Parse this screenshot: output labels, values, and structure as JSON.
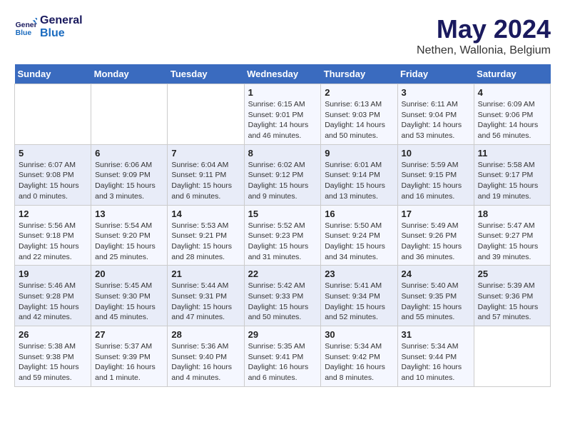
{
  "logo": {
    "line1": "General",
    "line2": "Blue"
  },
  "title": "May 2024",
  "subtitle": "Nethen, Wallonia, Belgium",
  "days_header": [
    "Sunday",
    "Monday",
    "Tuesday",
    "Wednesday",
    "Thursday",
    "Friday",
    "Saturday"
  ],
  "weeks": [
    [
      {
        "day": "",
        "detail": ""
      },
      {
        "day": "",
        "detail": ""
      },
      {
        "day": "",
        "detail": ""
      },
      {
        "day": "1",
        "detail": "Sunrise: 6:15 AM\nSunset: 9:01 PM\nDaylight: 14 hours\nand 46 minutes."
      },
      {
        "day": "2",
        "detail": "Sunrise: 6:13 AM\nSunset: 9:03 PM\nDaylight: 14 hours\nand 50 minutes."
      },
      {
        "day": "3",
        "detail": "Sunrise: 6:11 AM\nSunset: 9:04 PM\nDaylight: 14 hours\nand 53 minutes."
      },
      {
        "day": "4",
        "detail": "Sunrise: 6:09 AM\nSunset: 9:06 PM\nDaylight: 14 hours\nand 56 minutes."
      }
    ],
    [
      {
        "day": "5",
        "detail": "Sunrise: 6:07 AM\nSunset: 9:08 PM\nDaylight: 15 hours\nand 0 minutes."
      },
      {
        "day": "6",
        "detail": "Sunrise: 6:06 AM\nSunset: 9:09 PM\nDaylight: 15 hours\nand 3 minutes."
      },
      {
        "day": "7",
        "detail": "Sunrise: 6:04 AM\nSunset: 9:11 PM\nDaylight: 15 hours\nand 6 minutes."
      },
      {
        "day": "8",
        "detail": "Sunrise: 6:02 AM\nSunset: 9:12 PM\nDaylight: 15 hours\nand 9 minutes."
      },
      {
        "day": "9",
        "detail": "Sunrise: 6:01 AM\nSunset: 9:14 PM\nDaylight: 15 hours\nand 13 minutes."
      },
      {
        "day": "10",
        "detail": "Sunrise: 5:59 AM\nSunset: 9:15 PM\nDaylight: 15 hours\nand 16 minutes."
      },
      {
        "day": "11",
        "detail": "Sunrise: 5:58 AM\nSunset: 9:17 PM\nDaylight: 15 hours\nand 19 minutes."
      }
    ],
    [
      {
        "day": "12",
        "detail": "Sunrise: 5:56 AM\nSunset: 9:18 PM\nDaylight: 15 hours\nand 22 minutes."
      },
      {
        "day": "13",
        "detail": "Sunrise: 5:54 AM\nSunset: 9:20 PM\nDaylight: 15 hours\nand 25 minutes."
      },
      {
        "day": "14",
        "detail": "Sunrise: 5:53 AM\nSunset: 9:21 PM\nDaylight: 15 hours\nand 28 minutes."
      },
      {
        "day": "15",
        "detail": "Sunrise: 5:52 AM\nSunset: 9:23 PM\nDaylight: 15 hours\nand 31 minutes."
      },
      {
        "day": "16",
        "detail": "Sunrise: 5:50 AM\nSunset: 9:24 PM\nDaylight: 15 hours\nand 34 minutes."
      },
      {
        "day": "17",
        "detail": "Sunrise: 5:49 AM\nSunset: 9:26 PM\nDaylight: 15 hours\nand 36 minutes."
      },
      {
        "day": "18",
        "detail": "Sunrise: 5:47 AM\nSunset: 9:27 PM\nDaylight: 15 hours\nand 39 minutes."
      }
    ],
    [
      {
        "day": "19",
        "detail": "Sunrise: 5:46 AM\nSunset: 9:28 PM\nDaylight: 15 hours\nand 42 minutes."
      },
      {
        "day": "20",
        "detail": "Sunrise: 5:45 AM\nSunset: 9:30 PM\nDaylight: 15 hours\nand 45 minutes."
      },
      {
        "day": "21",
        "detail": "Sunrise: 5:44 AM\nSunset: 9:31 PM\nDaylight: 15 hours\nand 47 minutes."
      },
      {
        "day": "22",
        "detail": "Sunrise: 5:42 AM\nSunset: 9:33 PM\nDaylight: 15 hours\nand 50 minutes."
      },
      {
        "day": "23",
        "detail": "Sunrise: 5:41 AM\nSunset: 9:34 PM\nDaylight: 15 hours\nand 52 minutes."
      },
      {
        "day": "24",
        "detail": "Sunrise: 5:40 AM\nSunset: 9:35 PM\nDaylight: 15 hours\nand 55 minutes."
      },
      {
        "day": "25",
        "detail": "Sunrise: 5:39 AM\nSunset: 9:36 PM\nDaylight: 15 hours\nand 57 minutes."
      }
    ],
    [
      {
        "day": "26",
        "detail": "Sunrise: 5:38 AM\nSunset: 9:38 PM\nDaylight: 15 hours\nand 59 minutes."
      },
      {
        "day": "27",
        "detail": "Sunrise: 5:37 AM\nSunset: 9:39 PM\nDaylight: 16 hours\nand 1 minute."
      },
      {
        "day": "28",
        "detail": "Sunrise: 5:36 AM\nSunset: 9:40 PM\nDaylight: 16 hours\nand 4 minutes."
      },
      {
        "day": "29",
        "detail": "Sunrise: 5:35 AM\nSunset: 9:41 PM\nDaylight: 16 hours\nand 6 minutes."
      },
      {
        "day": "30",
        "detail": "Sunrise: 5:34 AM\nSunset: 9:42 PM\nDaylight: 16 hours\nand 8 minutes."
      },
      {
        "day": "31",
        "detail": "Sunrise: 5:34 AM\nSunset: 9:44 PM\nDaylight: 16 hours\nand 10 minutes."
      },
      {
        "day": "",
        "detail": ""
      }
    ]
  ]
}
